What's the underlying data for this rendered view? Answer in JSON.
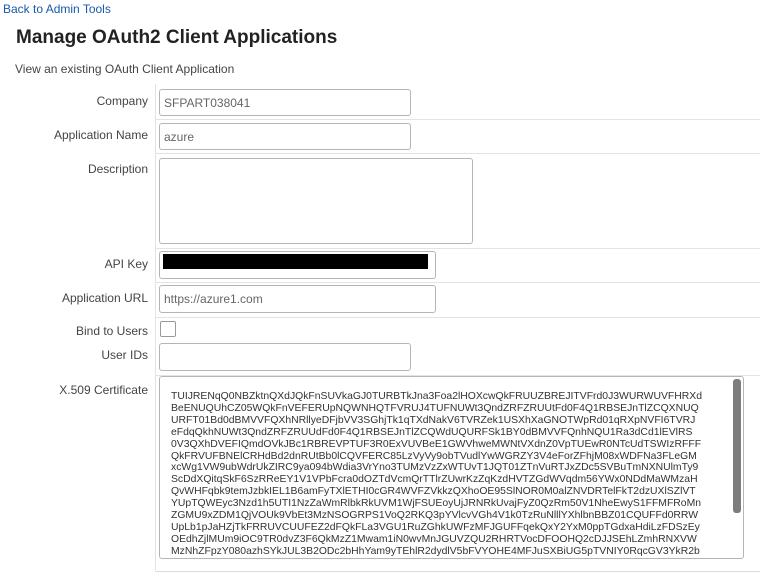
{
  "nav": {
    "back_link": "Back to Admin Tools"
  },
  "header": {
    "title": "Manage OAuth2 Client Applications",
    "subtitle": "View an existing OAuth Client Application"
  },
  "form": {
    "company": {
      "label": "Company",
      "value": "SFPART038041"
    },
    "application_name": {
      "label": "Application Name",
      "value": "azure"
    },
    "description": {
      "label": "Description",
      "value": ""
    },
    "api_key": {
      "label": "API Key",
      "value": ""
    },
    "application_url": {
      "label": "Application URL",
      "value": "https://azure1.com"
    },
    "bind_to_users": {
      "label": "Bind to Users",
      "checked": false
    },
    "user_ids": {
      "label": "User IDs",
      "value": ""
    },
    "certificate": {
      "label": "X.509 Certificate",
      "value": "TUIJRENqQ0NBZktnQXdJQkFnSUVkaGJ0TURBTkJna3Foa2lHOXcwQkFRUUZBREJITVFrd0J3WURWUVFHRXd\nBeENUQUhCZ05WQkFnVEFERUpNQWNHQTFVRUJ4TUFNUWt3QndZRFZRUUtFd0F4Q1RBSEJnTlZCQXNUQ\nURFT01Bd0dBMVVFQXhNRllyeDFjbVV3SGhjTk1qTXdNakV6TVRZek1USXhXaGNOTWpRd01qRXpNVFI6TVRJ\neFdqQkhNUWt3QndZRFZRUUdFd0F4Q1RBSEJnTlZCQWdUQURFSk1BY0dBMVVFQnhNQU1Ra3dCd1lEVlRS\n0V3QXhDVEFIQmdOVkJBc1RBREVPTUF3R0ExVUVBeE1GWVhweMWNtVXdnZ0VpTUEwR0NTcUdTSWIzRFFF\nQkFRVUFBNElCRHdBd2dnRUtBb0lCQVFERC85LzVyVy9obTVudlYwWGRZY3V4eForZFhjM08xWDFNa3FLeGM\nxcWg1VW9ubWdrUkZIRC9ya094bWdia3VrYno3TUMzVzZxWTUvT1JQT01ZTnVuRTJxZDc5SVBuTmNXNUlmTy9\nScDdXQitqSkF6SzRReEY1V1VPbFcra0dOZTdVcmQrTTlrZUwrKzZqKzdHVTZGdWVqdm56YWx0NDdMaWMzaH\nQvWHFqbk9temJzbkIEL1B6amFyTXlETHI0cGR4WVFZVkkzQXhoOE95SlNOR0M0alZNVDRTelFkT2dzUXlSZlVT\nYUpTQWEyc3Nzd1h5UTI1NzZaWmRlbkRkUVM1WjFSUEoyUjJRNRkUvajFyZ0QzRm50V1NheEwyS1FFMFRoMn\nZGMU9xZDM1QjVOUk9VbEt3MzNSOGRPS1VoQ2RKQ3pYVlcvVGh4V1k0TzRuNlllYXhlbnBBZ01CQUFFd0RRW\nUpLb1pJaHZjTkFRRUVCUUFEZ2dFQkFLa3VGU1RuZGhkUWFzMFJGUFFqekQxY2YxM0ppTGdxaHdiLzFDSzEy\nOEdhZjlMUm9iOC9TR0dvZ3F6QkMzZ1Mwam1iN0wvMnJGUVZQU2RHRTVocDFOOHQ2cDJJSEhLZmhRNXVW\nMzNhZFpzY080azhSYkJUL3B2ODc2bHhYam9yTEhlR2dydlV5bFVYOHE4MFJuSXBiUG5pTVNIY0RqcGV3YkR2b"
    }
  }
}
